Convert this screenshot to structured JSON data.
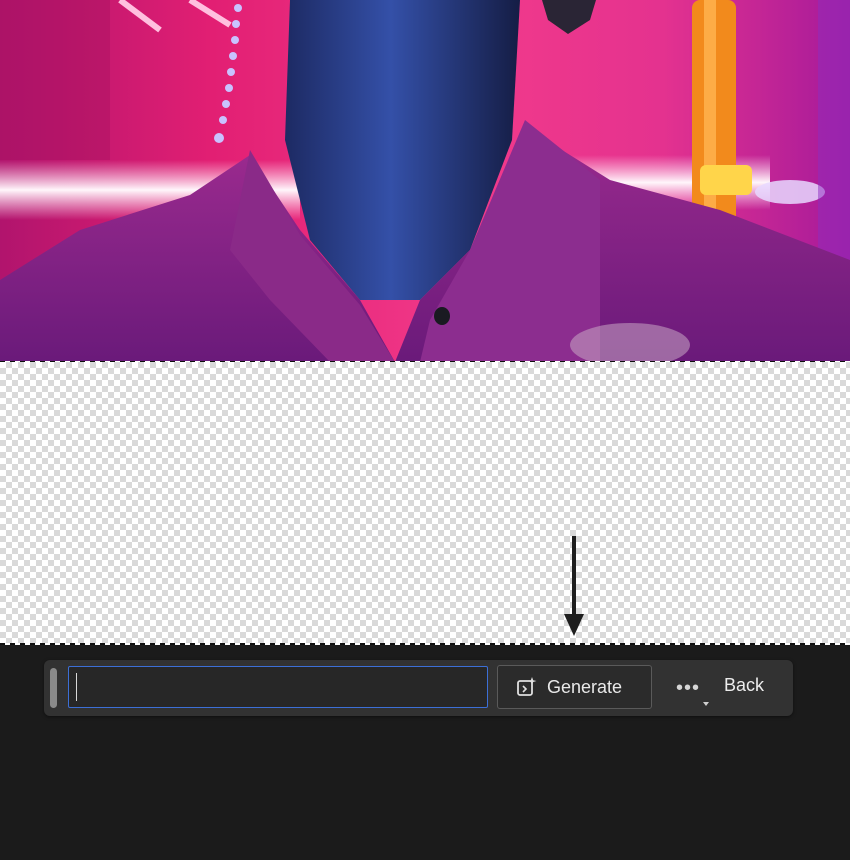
{
  "canvas": {
    "photo_description_icon": "photo-layer",
    "transparent_area": "checkerboard-transparency"
  },
  "task_bar": {
    "prompt_value": "",
    "prompt_placeholder": "",
    "generate_label": "Generate",
    "generate_icon": "generative-fill-icon",
    "more_icon": "more-options-icon",
    "back_label": "Back"
  },
  "colors": {
    "accent_focus": "#3c6fd6",
    "taskbar_bg": "#323232",
    "workspace_bg": "#1b1b1b"
  }
}
